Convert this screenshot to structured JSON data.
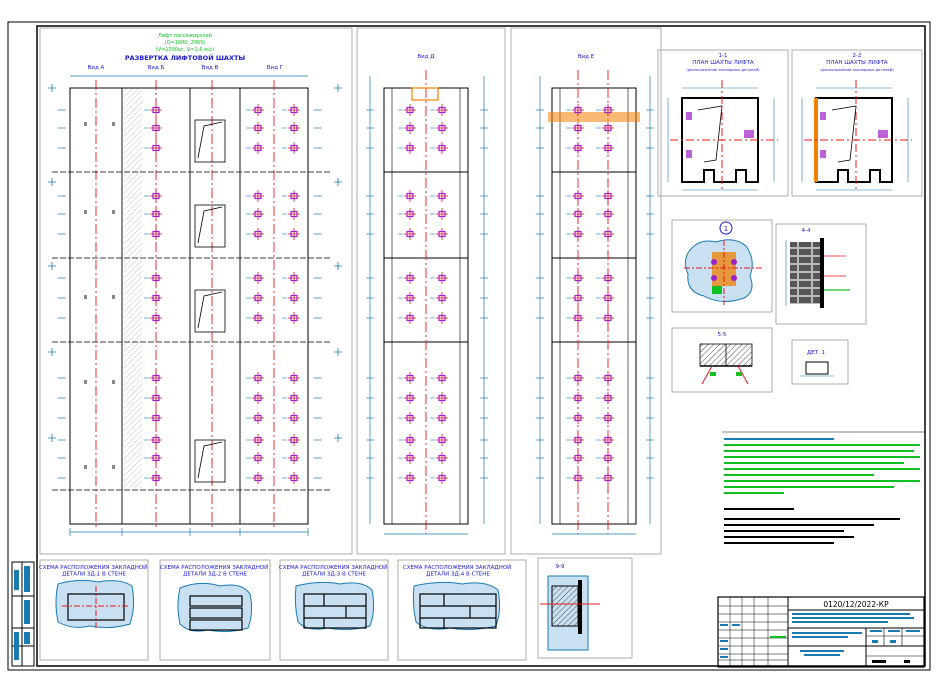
{
  "drawing": {
    "title_green_1": "Лифт пассажирский",
    "title_green_2": "(Q=1000, 2065)",
    "title_green_3": "(V=1000кг, V=1,6 м/с)",
    "development_title": "РАЗВЕРТКА ЛИФТОВОЙ ШАХТЫ",
    "view_a": "Вид А",
    "view_b": "Вид Б",
    "view_v": "Вид В",
    "view_g": "Вид Г",
    "view_d": "Вид Д",
    "view_e": "Вид Е",
    "plan_11_title": "1-1",
    "plan_11_sub": "ПЛАН ШАХТЫ ЛИФТА",
    "plan_11_note": "(расположение закладных деталей)",
    "plan_22_title": "2-2",
    "plan_22_sub": "ПЛАН ШАХТЫ ЛИФТА",
    "plan_22_note": "(расположение закладных деталей)",
    "node_number": "1",
    "section_44": "4-4",
    "section_55": "5-5",
    "det_label": "ДЕТ. 1",
    "section_99": "9-9",
    "scheme_1": "СХЕМА РАСПОЛОЖЕНИЯ ЗАКЛАДНОЙ\nДЕТАЛИ ЗД-1 В СТЕНЕ",
    "scheme_2": "СХЕМА РАСПОЛОЖЕНИЯ ЗАКЛАДНОЙ\nДЕТАЛИ ЗД-2 В СТЕНЕ",
    "scheme_3": "СХЕМА РАСПОЛОЖЕНИЯ ЗАКЛАДНОЙ\nДЕТАЛИ ЗД-3 В СТЕНЕ",
    "scheme_4": "СХЕМА РАСПОЛОЖЕНИЯ ЗАКЛАДНОЙ\nДЕТАЛИ ЗД-4 В СТЕНЕ",
    "doc_code": "0120/12/2022-КР",
    "colors": {
      "frame": "#000000",
      "dim": "#1a7bb0",
      "axis": "#e8171a",
      "embed": "#a020c8",
      "green": "#10c020",
      "orange": "#f08000"
    }
  }
}
